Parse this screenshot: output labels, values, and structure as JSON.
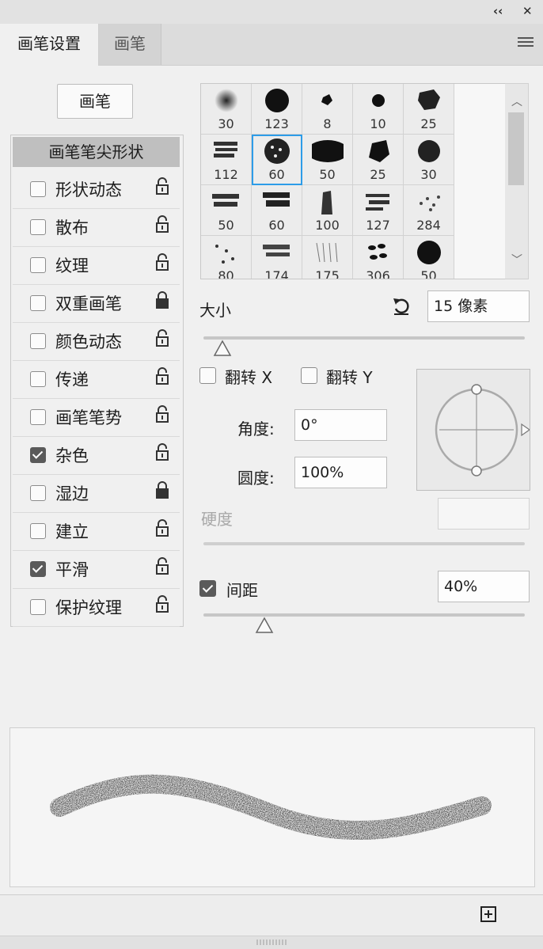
{
  "window": {
    "collapse_icon": "double-chevron-left-icon",
    "close_icon": "close-icon",
    "collapse_glyph": "‹‹",
    "close_glyph": "✕"
  },
  "tabs": [
    {
      "label": "画笔设置",
      "active": true
    },
    {
      "label": "画笔",
      "active": false
    }
  ],
  "panel_menu_icon": "hamburger-menu-icon",
  "brushes_button_label": "画笔",
  "sidebar": {
    "header": "画笔笔尖形状",
    "items": [
      {
        "label": "形状动态",
        "checked": false,
        "lock": "unlocked"
      },
      {
        "label": "散布",
        "checked": false,
        "lock": "unlocked"
      },
      {
        "label": "纹理",
        "checked": false,
        "lock": "unlocked"
      },
      {
        "label": "双重画笔",
        "checked": false,
        "lock": "locked"
      },
      {
        "label": "颜色动态",
        "checked": false,
        "lock": "unlocked"
      },
      {
        "label": "传递",
        "checked": false,
        "lock": "unlocked"
      },
      {
        "label": "画笔笔势",
        "checked": false,
        "lock": "unlocked"
      },
      {
        "label": "杂色",
        "checked": true,
        "lock": "unlocked"
      },
      {
        "label": "湿边",
        "checked": false,
        "lock": "locked"
      },
      {
        "label": "建立",
        "checked": false,
        "lock": "unlocked"
      },
      {
        "label": "平滑",
        "checked": true,
        "lock": "unlocked"
      },
      {
        "label": "保护纹理",
        "checked": false,
        "lock": "unlocked"
      }
    ]
  },
  "brush_grid": {
    "sizes": [
      "30",
      "123",
      "8",
      "10",
      "25",
      "112",
      "60",
      "50",
      "25",
      "30",
      "50",
      "60",
      "100",
      "127",
      "284",
      "80",
      "174",
      "175",
      "306",
      "50"
    ],
    "selected_index": 6,
    "scroll_up_icon": "chevron-up-icon",
    "scroll_down_icon": "chevron-down-icon",
    "scroll_up_glyph": "︿",
    "scroll_down_glyph": "﹀"
  },
  "size": {
    "label": "大小",
    "value": "15 像素",
    "reset_icon": "reset-arrow-icon",
    "slider_level": 0.06
  },
  "flip_x": {
    "label": "翻转 X",
    "checked": false
  },
  "flip_y": {
    "label": "翻转 Y",
    "checked": false
  },
  "angle": {
    "label": "角度:",
    "value": "0°"
  },
  "roundness": {
    "label": "圆度:",
    "value": "100%"
  },
  "hardness": {
    "label": "硬度",
    "value": "",
    "disabled": true
  },
  "spacing": {
    "label": "间距",
    "checked": true,
    "value": "40%",
    "slider_level": 0.19
  },
  "preview_icon": "brush-stroke-preview",
  "new_preset_icon": "add-square-icon",
  "colors": {
    "selection": "#2d9ce8",
    "panel_bg": "#f0f0f0"
  }
}
